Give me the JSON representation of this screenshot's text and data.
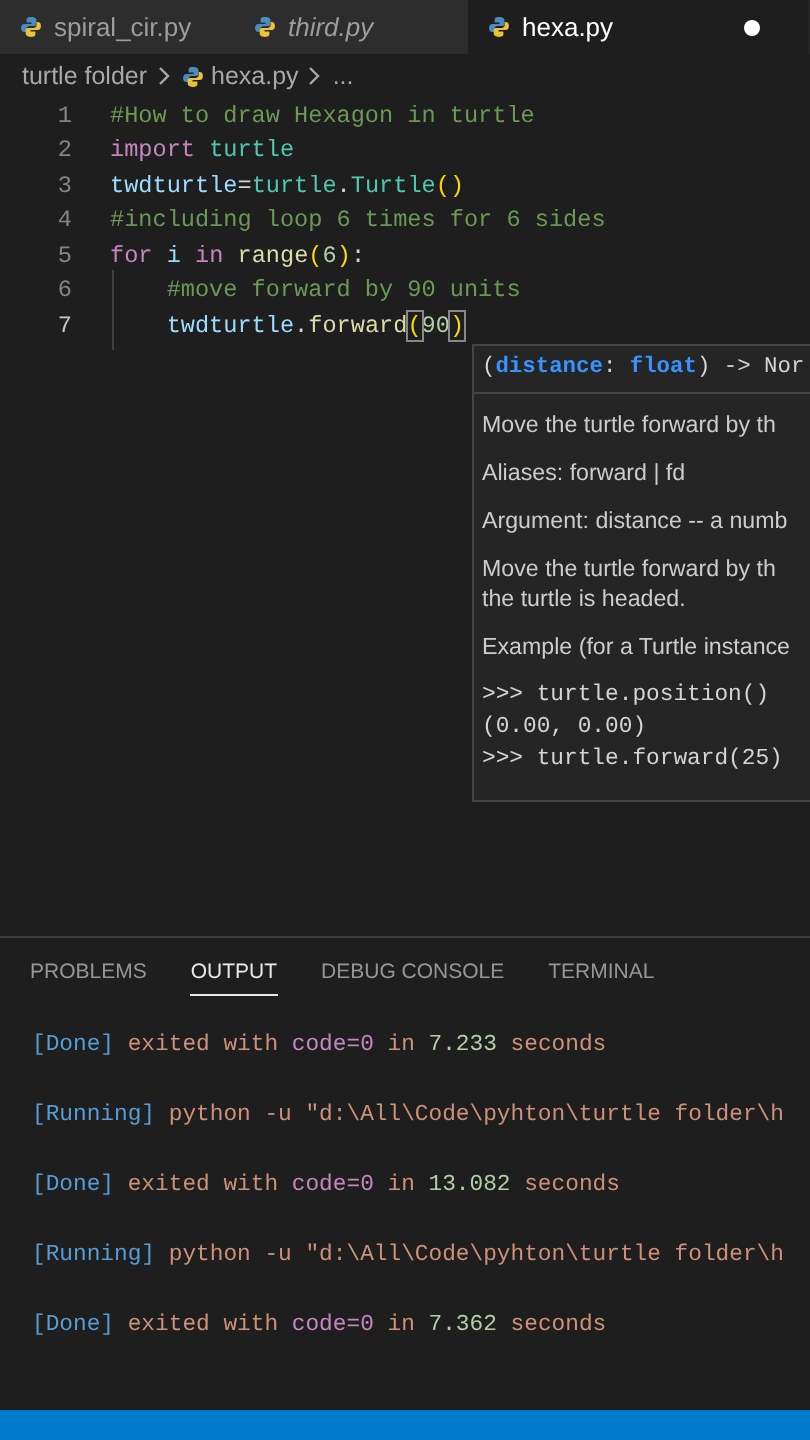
{
  "tabs": [
    {
      "label": "spiral_cir.py",
      "selected": false,
      "preview": false,
      "modified": false
    },
    {
      "label": "third.py",
      "selected": false,
      "preview": true,
      "modified": false
    },
    {
      "label": "hexa.py",
      "selected": true,
      "preview": false,
      "modified": true
    }
  ],
  "breadcrumb": [
    {
      "label": "turtle folder",
      "kind": "folder"
    },
    {
      "label": "hexa.py",
      "kind": "file"
    },
    {
      "label": "...",
      "kind": "more"
    }
  ],
  "editor": {
    "lines": [
      {
        "number": "1",
        "tokens": [
          {
            "text": "#How to draw Hexagon in turtle",
            "kind": "comment"
          }
        ]
      },
      {
        "number": "2",
        "tokens": [
          {
            "text": "import ",
            "kind": "keyword"
          },
          {
            "text": "turtle",
            "kind": "class"
          }
        ]
      },
      {
        "number": "3",
        "tokens": [
          {
            "text": "twdturtle",
            "kind": "variable"
          },
          {
            "text": "=",
            "kind": "plain"
          },
          {
            "text": "turtle",
            "kind": "class"
          },
          {
            "text": ".",
            "kind": "plain"
          },
          {
            "text": "Turtle",
            "kind": "class"
          },
          {
            "text": "()",
            "kind": "paren"
          }
        ]
      },
      {
        "number": "4",
        "tokens": [
          {
            "text": "#including loop 6 times for 6 sides",
            "kind": "comment"
          }
        ]
      },
      {
        "number": "5",
        "tokens": [
          {
            "text": "for ",
            "kind": "keyword"
          },
          {
            "text": "i ",
            "kind": "variable"
          },
          {
            "text": "in ",
            "kind": "keyword"
          },
          {
            "text": "range",
            "kind": "function"
          },
          {
            "text": "(",
            "kind": "paren"
          },
          {
            "text": "6",
            "kind": "number"
          },
          {
            "text": ")",
            "kind": "paren"
          },
          {
            "text": ":",
            "kind": "plain"
          }
        ]
      },
      {
        "number": "6",
        "tokens": [
          {
            "text": "    #move forward by 90 units",
            "kind": "comment"
          }
        ]
      },
      {
        "number": "7",
        "tokens": [
          {
            "text": "    twdturtle",
            "kind": "variable"
          },
          {
            "text": ".",
            "kind": "plain"
          },
          {
            "text": "forward",
            "kind": "function"
          },
          {
            "text": "(",
            "kind": "bracket-match"
          },
          {
            "text": "90",
            "kind": "number"
          },
          {
            "text": ")",
            "kind": "bracket-match"
          }
        ]
      }
    ]
  },
  "hover": {
    "signature": [
      {
        "text": "(",
        "kind": "plain"
      },
      {
        "text": "distance",
        "kind": "param"
      },
      {
        "text": ": ",
        "kind": "plain"
      },
      {
        "text": "float",
        "kind": "param"
      },
      {
        "text": ") -> Nor",
        "kind": "plain"
      }
    ],
    "sections": [
      {
        "kind": "text",
        "text": "Move the turtle forward by th"
      },
      {
        "kind": "text",
        "text": "Aliases: forward | fd"
      },
      {
        "kind": "text",
        "text": "Argument: distance -- a numb"
      },
      {
        "kind": "text",
        "text": "Move the turtle forward by th\nthe turtle is headed."
      },
      {
        "kind": "text",
        "text": "Example (for a Turtle instance"
      },
      {
        "kind": "code",
        "text": ">>> turtle.position()\n(0.00, 0.00)\n>>> turtle.forward(25)"
      }
    ]
  },
  "panel": {
    "tabs": [
      {
        "label": "PROBLEMS",
        "selected": false
      },
      {
        "label": "OUTPUT",
        "selected": true
      },
      {
        "label": "DEBUG CONSOLE",
        "selected": false
      },
      {
        "label": "TERMINAL",
        "selected": false
      }
    ],
    "output": [
      [
        {
          "text": "[Done]",
          "kind": "tag"
        },
        {
          "text": " exited with ",
          "kind": "text"
        },
        {
          "text": "code=0",
          "kind": "code"
        },
        {
          "text": " in ",
          "kind": "text"
        },
        {
          "text": "7.233",
          "kind": "number"
        },
        {
          "text": " seconds",
          "kind": "text"
        }
      ],
      [
        {
          "text": "[Running]",
          "kind": "tag"
        },
        {
          "text": " python -u \"d:\\All\\Code\\pyhton\\turtle folder\\h",
          "kind": "text"
        }
      ],
      [
        {
          "text": "[Done]",
          "kind": "tag"
        },
        {
          "text": " exited with ",
          "kind": "text"
        },
        {
          "text": "code=0",
          "kind": "code"
        },
        {
          "text": " in ",
          "kind": "text"
        },
        {
          "text": "13.082",
          "kind": "number"
        },
        {
          "text": " seconds",
          "kind": "text"
        }
      ],
      [
        {
          "text": "[Running]",
          "kind": "tag"
        },
        {
          "text": " python -u \"d:\\All\\Code\\pyhton\\turtle folder\\h",
          "kind": "text"
        }
      ],
      [
        {
          "text": "[Done]",
          "kind": "tag"
        },
        {
          "text": " exited with ",
          "kind": "text"
        },
        {
          "text": "code=0",
          "kind": "code"
        },
        {
          "text": " in ",
          "kind": "text"
        },
        {
          "text": "7.362",
          "kind": "number"
        },
        {
          "text": " seconds",
          "kind": "text"
        }
      ]
    ]
  }
}
